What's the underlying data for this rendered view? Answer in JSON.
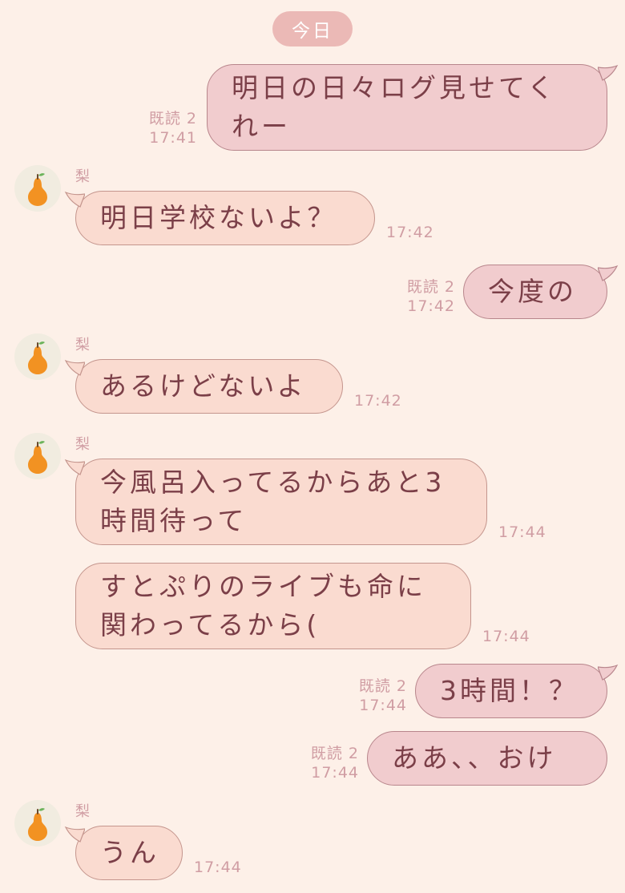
{
  "date_label": "今日",
  "read_label": "既読 2",
  "sender": {
    "name": "梨",
    "avatar_icon": "pear-icon"
  },
  "messages": [
    {
      "from": "me",
      "lines": [
        "明日の日々ログ見せてく",
        "れー"
      ],
      "time": "17:41"
    },
    {
      "from": "them",
      "lines": [
        "明日学校ないよ？"
      ],
      "time": "17:42"
    },
    {
      "from": "me",
      "lines": [
        "今度の"
      ],
      "time": "17:42"
    },
    {
      "from": "them",
      "lines": [
        "あるけどないよ"
      ],
      "time": "17:42"
    },
    {
      "from": "them",
      "lines": [
        "今風呂入ってるからあと3",
        "時間待って"
      ],
      "time": "17:44"
    },
    {
      "from": "them",
      "lines": [
        "すとぷりのライブも命に",
        "関わってるから("
      ],
      "time": "17:44"
    },
    {
      "from": "me",
      "lines": [
        "3時間！？"
      ],
      "time": "17:44"
    },
    {
      "from": "me",
      "lines": [
        "ああ、、おけ"
      ],
      "time": "17:44"
    },
    {
      "from": "them",
      "lines": [
        "うん"
      ],
      "time": "17:44"
    }
  ],
  "colors": {
    "background": "#fdf0e8",
    "my_bubble": "#f1ccce",
    "their_bubble": "#fadbd0",
    "text": "#7b3f48",
    "meta": "#d09da3",
    "date_pill": "#ebb9b6"
  }
}
